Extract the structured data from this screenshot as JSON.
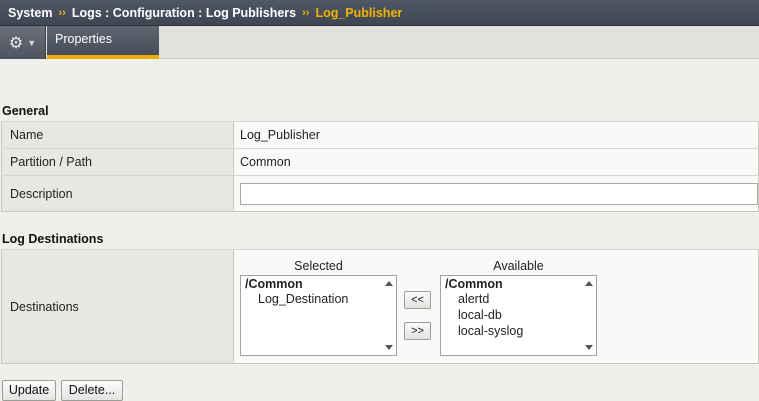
{
  "breadcrumb": {
    "system": "System",
    "sep1": "››",
    "path": "Logs : Configuration : Log Publishers",
    "sep2": "››",
    "current": "Log_Publisher"
  },
  "tabs": {
    "gear_icon": "gear-icon",
    "properties": "Properties"
  },
  "general": {
    "title": "General",
    "rows": [
      {
        "label": "Name",
        "value": "Log_Publisher"
      },
      {
        "label": "Partition / Path",
        "value": "Common"
      },
      {
        "label": "Description",
        "value": ""
      }
    ]
  },
  "log_destinations": {
    "title": "Log Destinations",
    "label": "Destinations",
    "selected": {
      "caption": "Selected",
      "group": "/Common",
      "items": [
        "Log_Destination"
      ]
    },
    "available": {
      "caption": "Available",
      "group": "/Common",
      "items": [
        "alertd",
        "local-db",
        "local-syslog"
      ]
    },
    "move_left": "<<",
    "move_right": ">>"
  },
  "buttons": {
    "update": "Update",
    "delete": "Delete..."
  },
  "colors": {
    "accent": "#f0ad00",
    "header_bg": "#3e4652",
    "page_bg": "#efefec"
  }
}
